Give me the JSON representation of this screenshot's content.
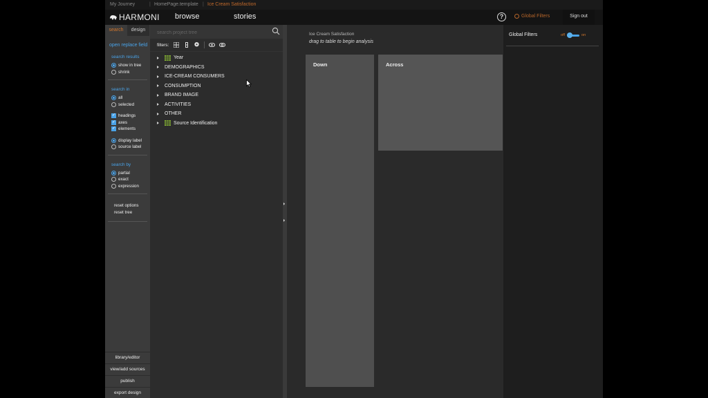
{
  "breadcrumbs": [
    "My Journey",
    "HomePage.template",
    "Ice Cream Satisfaction"
  ],
  "header": {
    "logo_text": "HARMONI",
    "nav": [
      "browse",
      "stories"
    ],
    "help_icon": "question-circle-icon",
    "global_filters_label": "Global Filters",
    "sign_out_label": "Sign out"
  },
  "left_panel": {
    "tabs": [
      "search",
      "design"
    ],
    "open_replace_field": "open replace field",
    "search_results": {
      "title": "search results",
      "options": [
        "show in tree",
        "shrink"
      ],
      "selected": "show in tree"
    },
    "search_in": {
      "title": "search in",
      "options": [
        "all",
        "selected"
      ],
      "selected": "all"
    },
    "checks": [
      "headings",
      "axes",
      "elements"
    ],
    "label_type": {
      "options": [
        "display label",
        "source label"
      ],
      "selected": "display label"
    },
    "search_by": {
      "title": "search by",
      "options": [
        "partial",
        "exact",
        "expression"
      ],
      "selected": "partial"
    },
    "reset_options": "reset options",
    "reset_tree": "reset tree",
    "bottom_buttons": [
      "library/editor",
      "view/add sources",
      "publish",
      "export design"
    ]
  },
  "tree_panel": {
    "search_placeholder": "search project tree",
    "filters_label": "filters:",
    "nodes": [
      {
        "label": "Year",
        "icon": "table-icon"
      },
      {
        "label": "DEMOGRAPHICS"
      },
      {
        "label": "ICE-CREAM CONSUMERS"
      },
      {
        "label": "CONSUMPTION"
      },
      {
        "label": "BRAND IMAGE"
      },
      {
        "label": "ACTIVITIES"
      },
      {
        "label": "OTHER"
      },
      {
        "label": "Source Identification",
        "icon": "table-icon"
      }
    ]
  },
  "main": {
    "title": "Ice Cream Satisfaction",
    "hint": "drag to table to begin analysis",
    "down_label": "Down",
    "across_label": "Across"
  },
  "right_panel": {
    "title": "Global Filters",
    "toggle_off": "off",
    "toggle_on": "on",
    "toggle_state": "off"
  },
  "colors": {
    "accent_orange": "#d2772d",
    "accent_blue": "#4aa3e8"
  }
}
